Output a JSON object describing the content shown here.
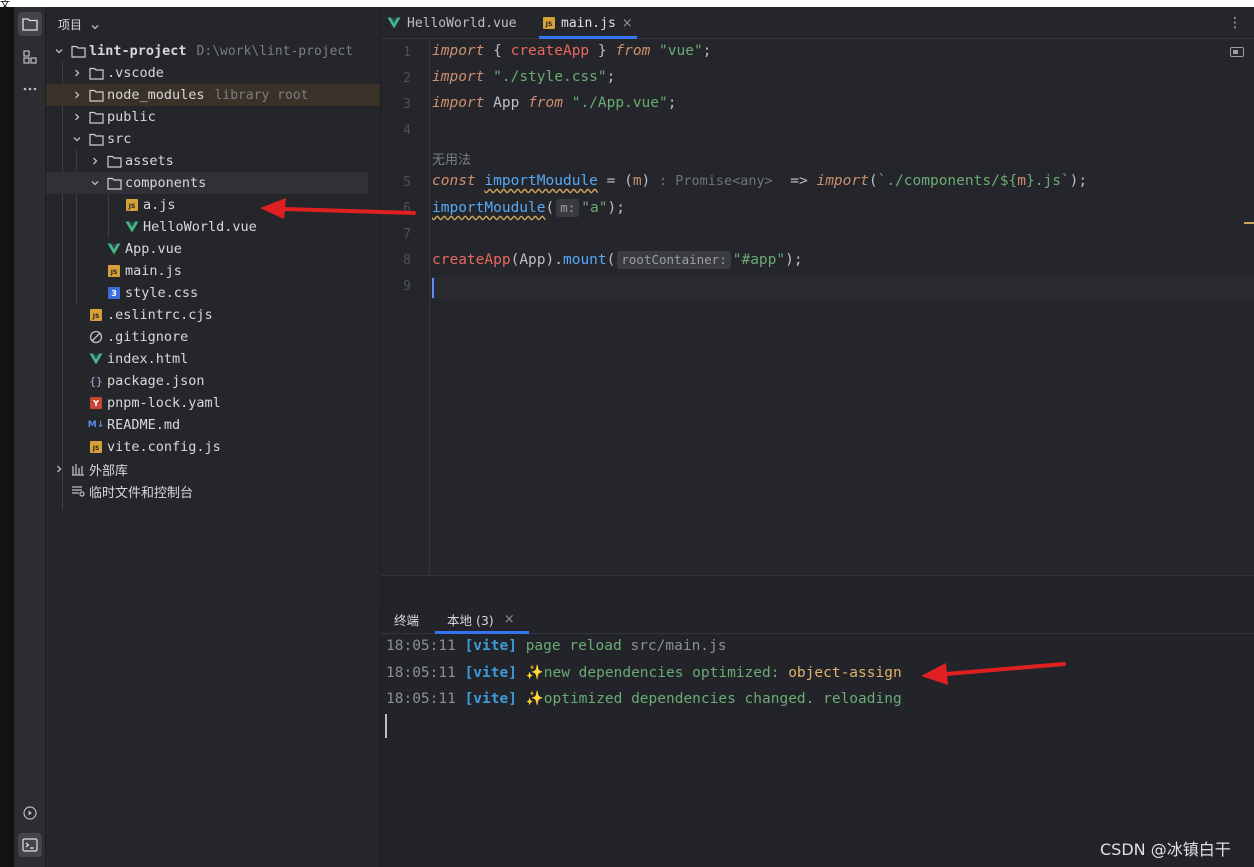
{
  "top_strip": {
    "glyph": "文"
  },
  "project_panel": {
    "title": "项目",
    "tree": [
      {
        "name": "lint-project",
        "hint": "D:\\work\\lint-project",
        "icon": "folder-icon"
      },
      {
        "name": ".vscode",
        "icon": "folder-icon"
      },
      {
        "name": "node_modules",
        "hint": "library root",
        "icon": "folder-icon"
      },
      {
        "name": "public",
        "icon": "folder-icon"
      },
      {
        "name": "src",
        "icon": "folder-icon"
      },
      {
        "name": "assets",
        "icon": "folder-icon"
      },
      {
        "name": "components",
        "icon": "folder-icon"
      },
      {
        "name": "a.js",
        "icon": "js-file-icon",
        "badge": "JS"
      },
      {
        "name": "HelloWorld.vue",
        "icon": "vue-file-icon"
      },
      {
        "name": "App.vue",
        "icon": "vue-file-icon"
      },
      {
        "name": "main.js",
        "icon": "js-file-icon",
        "badge": "JS"
      },
      {
        "name": "style.css",
        "icon": "css-file-icon",
        "badge": "3"
      },
      {
        "name": ".eslintrc.cjs",
        "icon": "js-file-icon",
        "badge": "JS"
      },
      {
        "name": ".gitignore",
        "icon": "gitignore-icon"
      },
      {
        "name": "index.html",
        "icon": "vue-file-icon"
      },
      {
        "name": "package.json",
        "icon": "json-file-icon",
        "badge": "{}"
      },
      {
        "name": "pnpm-lock.yaml",
        "icon": "yaml-file-icon",
        "badge": "Y"
      },
      {
        "name": "README.md",
        "icon": "markdown-file-icon",
        "badge": "M↓"
      },
      {
        "name": "vite.config.js",
        "icon": "js-file-icon",
        "badge": "JS"
      },
      {
        "name": "外部库",
        "icon": "library-icon"
      },
      {
        "name": "临时文件和控制台",
        "icon": "scratches-icon"
      }
    ]
  },
  "editor": {
    "tabs": [
      {
        "label": "HelloWorld.vue",
        "icon": "vue-file-icon"
      },
      {
        "label": "main.js",
        "icon": "js-file-icon",
        "badge": "JS",
        "close": "×"
      }
    ],
    "more": "⋮",
    "line_numbers": [
      "1",
      "2",
      "3",
      "4",
      "5",
      "6",
      "7",
      "8",
      "9"
    ],
    "code": {
      "import_kw": "import",
      "from_kw": "from",
      "const_kw": "const",
      "create_app": "createApp",
      "vue_str": "\"vue\"",
      "style_str": "\"./style.css\"",
      "app_ident": "App",
      "app_vue_str": "\"./App.vue\"",
      "comment": "无用法",
      "import_moudule": "importMoudule",
      "param_m": "m",
      "type_hint": ": Promise<any>",
      "template_str_a": "`./components/${",
      "template_str_b": "}.js`",
      "inlay_m": "m:",
      "a_str": "\"a\"",
      "mount": "mount",
      "inlay_root": "rootContainer:",
      "app_str": "\"#app\""
    }
  },
  "terminal": {
    "tabs": [
      {
        "label": "终端"
      },
      {
        "label": "本地 (3)",
        "close": "×"
      }
    ],
    "lines": [
      {
        "time": "18:05:11",
        "tag": "[vite]",
        "text": "page reload",
        "path": "src/main.js"
      },
      {
        "time": "18:05:11",
        "tag": "[vite]",
        "sparkle": "✨",
        "text": "new dependencies optimized:",
        "dep": "object-assign"
      },
      {
        "time": "18:05:11",
        "tag": "[vite]",
        "sparkle": "✨",
        "text": "optimized dependencies changed. reloading"
      }
    ]
  },
  "watermark": "CSDN @冰镇白干",
  "colors": {
    "accent": "#3574f0",
    "annotation_arrow": "#e02020"
  }
}
